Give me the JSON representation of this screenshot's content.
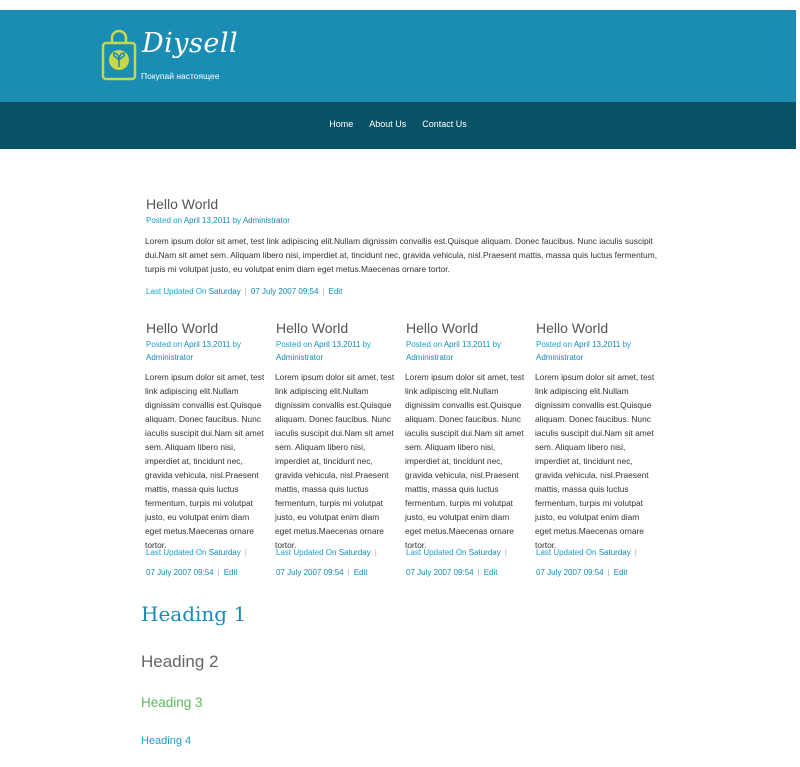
{
  "site": {
    "name": "Diysell",
    "tagline": "Покупай настоящее",
    "logo_icon": "shopping-bag-leaf-icon"
  },
  "nav": {
    "items": [
      "Home",
      "About Us",
      "Contact Us"
    ]
  },
  "featured": {
    "title": "Hello World",
    "posted_on_label": "Posted on",
    "date": "April 13,2011",
    "by_label": "by",
    "author": "Administrator",
    "text": " Lorem ipsum dolor sit amet, test link adipiscing elit.Nullam dignissim convallis est.Quisque aliquam. Donec faucibus. Nunc iaculis suscipit dui.Nam sit amet sem. Aliquam libero nisi, imperdiet at, tincidunt nec, gravida vehicula, nisl.Praesent mattis, massa quis luctus fermentum, turpis mi volutpat justo, eu volutpat enim diam eget metus.Maecenas ornare tortor.",
    "updated_label": "Last Updated On",
    "updated_day": "Saturday",
    "updated_date": "07 July 2007 09:54",
    "edit_label": "Edit"
  },
  "posts": [
    {
      "title": "Hello World",
      "posted_on_label": "Posted on",
      "date": "April 13,2011",
      "by_label": "by",
      "author": "Administrator",
      "text": " Lorem ipsum dolor sit amet, test link adipiscing elit.Nullam dignissim convallis est.Quisque aliquam. Donec faucibus. Nunc iaculis suscipit dui.Nam sit amet sem. Aliquam libero nisi, imperdiet at, tincidunt nec, gravida vehicula, nisl.Praesent mattis, massa quis luctus fermentum, turpis mi volutpat justo, eu volutpat enim diam eget metus.Maecenas ornare tortor.",
      "updated_label": "Last Updated On",
      "updated_day": "Saturday",
      "updated_date": "07 July 2007 09:54",
      "edit_label": "Edit"
    },
    {
      "title": "Hello World",
      "posted_on_label": "Posted on",
      "date": "April 13,2011",
      "by_label": "by",
      "author": "Administrator",
      "text": " Lorem ipsum dolor sit amet, test link adipiscing elit.Nullam dignissim convallis est.Quisque aliquam. Donec faucibus. Nunc iaculis suscipit dui.Nam sit amet sem. Aliquam libero nisi, imperdiet at, tincidunt nec, gravida vehicula, nisl.Praesent mattis, massa quis luctus fermentum, turpis mi volutpat justo, eu volutpat enim diam eget metus.Maecenas ornare tortor.",
      "updated_label": "Last Updated On",
      "updated_day": "Saturday",
      "updated_date": "07 July 2007 09:54",
      "edit_label": "Edit"
    },
    {
      "title": "Hello World",
      "posted_on_label": "Posted on",
      "date": "April 13,2011",
      "by_label": "by",
      "author": "Administrator",
      "text": " Lorem ipsum dolor sit amet, test link adipiscing elit.Nullam dignissim convallis est.Quisque aliquam. Donec faucibus. Nunc iaculis suscipit dui.Nam sit amet sem. Aliquam libero nisi, imperdiet at, tincidunt nec, gravida vehicula, nisl.Praesent mattis, massa quis luctus fermentum, turpis mi volutpat justo, eu volutpat enim diam eget metus.Maecenas ornare tortor.",
      "updated_label": "Last Updated On",
      "updated_day": "Saturday",
      "updated_date": "07 July 2007 09:54",
      "edit_label": "Edit"
    },
    {
      "title": "Hello World",
      "posted_on_label": "Posted on",
      "date": "April 13,2011",
      "by_label": "by",
      "author": "Administrator",
      "text": " Lorem ipsum dolor sit amet, test link adipiscing elit.Nullam dignissim convallis est.Quisque aliquam. Donec faucibus. Nunc iaculis suscipit dui.Nam sit amet sem. Aliquam libero nisi, imperdiet at, tincidunt nec, gravida vehicula, nisl.Praesent mattis, massa quis luctus fermentum, turpis mi volutpat justo, eu volutpat enim diam eget metus.Maecenas ornare tortor.",
      "updated_label": "Last Updated On",
      "updated_day": "Saturday",
      "updated_date": "07 July 2007 09:54",
      "edit_label": "Edit"
    }
  ],
  "headings": {
    "h1": "Heading 1",
    "h2": "Heading 2",
    "h3": "Heading 3",
    "h4": "Heading 4"
  },
  "colors": {
    "header_bg": "#1b8db4",
    "nav_bg": "#095266",
    "logo_accent": "#c8d84a",
    "link": "#1b9fd1",
    "heading3": "#5cb85c"
  }
}
